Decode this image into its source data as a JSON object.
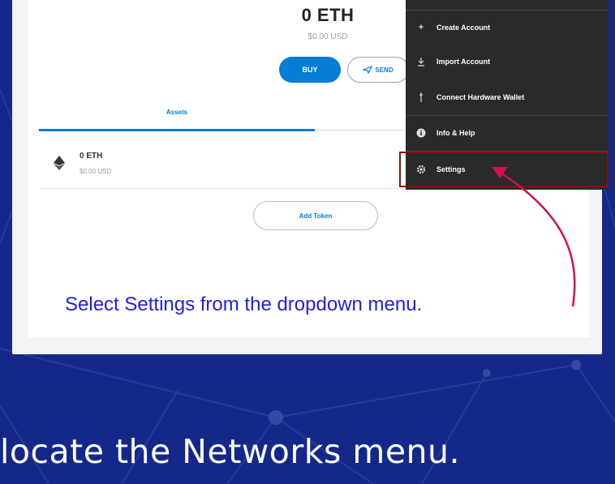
{
  "colors": {
    "background": "#15288a",
    "accent": "#037dd6",
    "menu_bg": "#2a2a2a",
    "highlight_border": "#8b1010",
    "arrow": "#d0124a",
    "caption": "#1f1fd8"
  },
  "wallet": {
    "balance": "0 ETH",
    "balance_usd": "$0.00 USD",
    "buy_label": "BUY",
    "send_label": "SEND",
    "tabs": [
      {
        "label": "Assets",
        "active": true
      }
    ],
    "assets": [
      {
        "amount": "0 ETH",
        "usd": "$0.00 USD",
        "icon": "ethereum-icon"
      }
    ],
    "add_token_label": "Add Token"
  },
  "menu": {
    "items": [
      {
        "label": "Create Account",
        "icon": "plus-icon"
      },
      {
        "label": "Import Account",
        "icon": "download-icon"
      },
      {
        "label": "Connect Hardware Wallet",
        "icon": "usb-icon"
      },
      {
        "label": "Info & Help",
        "icon": "info-icon"
      },
      {
        "label": "Settings",
        "icon": "gear-icon",
        "highlighted": true
      }
    ]
  },
  "caption": "Select Settings from the dropdown menu.",
  "slide_text": "locate the Networks menu."
}
